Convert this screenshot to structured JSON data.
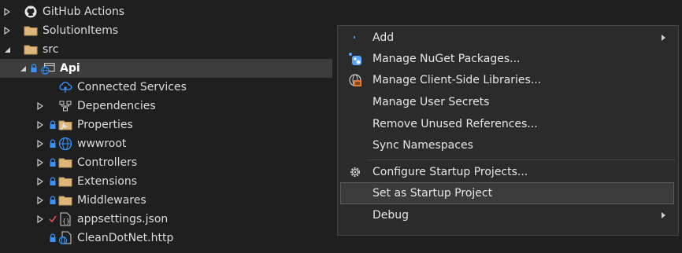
{
  "tree": {
    "items": [
      {
        "label": "GitHub Actions",
        "icon": "github-icon"
      },
      {
        "label": "SolutionItems",
        "icon": "folder-icon"
      },
      {
        "label": "src",
        "icon": "folder-icon"
      },
      {
        "label": "Api",
        "icon": "web-project-icon"
      },
      {
        "label": "Connected Services",
        "icon": "connected-services-icon"
      },
      {
        "label": "Dependencies",
        "icon": "dependencies-icon"
      },
      {
        "label": "Properties",
        "icon": "properties-folder-icon"
      },
      {
        "label": "wwwroot",
        "icon": "globe-icon"
      },
      {
        "label": "Controllers",
        "icon": "folder-icon"
      },
      {
        "label": "Extensions",
        "icon": "folder-icon"
      },
      {
        "label": "Middlewares",
        "icon": "folder-icon"
      },
      {
        "label": "appsettings.json",
        "icon": "json-file-icon"
      },
      {
        "label": "CleanDotNet.http",
        "icon": "http-file-icon"
      }
    ]
  },
  "context_menu": {
    "items": [
      {
        "label": "Add",
        "icon": "",
        "submenu": true
      },
      {
        "label": "Manage NuGet Packages...",
        "icon": "nuget-icon"
      },
      {
        "label": "Manage Client-Side Libraries...",
        "icon": "libman-icon"
      },
      {
        "label": "Manage User Secrets",
        "icon": ""
      },
      {
        "label": "Remove Unused References...",
        "icon": ""
      },
      {
        "label": "Sync Namespaces",
        "icon": ""
      },
      {
        "label": "Configure Startup Projects...",
        "icon": "gear-icon"
      },
      {
        "label": "Set as Startup Project",
        "icon": "",
        "highlighted": true
      },
      {
        "label": "Debug",
        "icon": "",
        "submenu": true
      }
    ]
  },
  "colors": {
    "background": "#1f1f1f",
    "menu_background": "#2b2b2b",
    "selection": "#3c3c3c",
    "folder": "#dcb67a",
    "accent_blue": "#3794ff",
    "modified_check": "#e05252"
  }
}
